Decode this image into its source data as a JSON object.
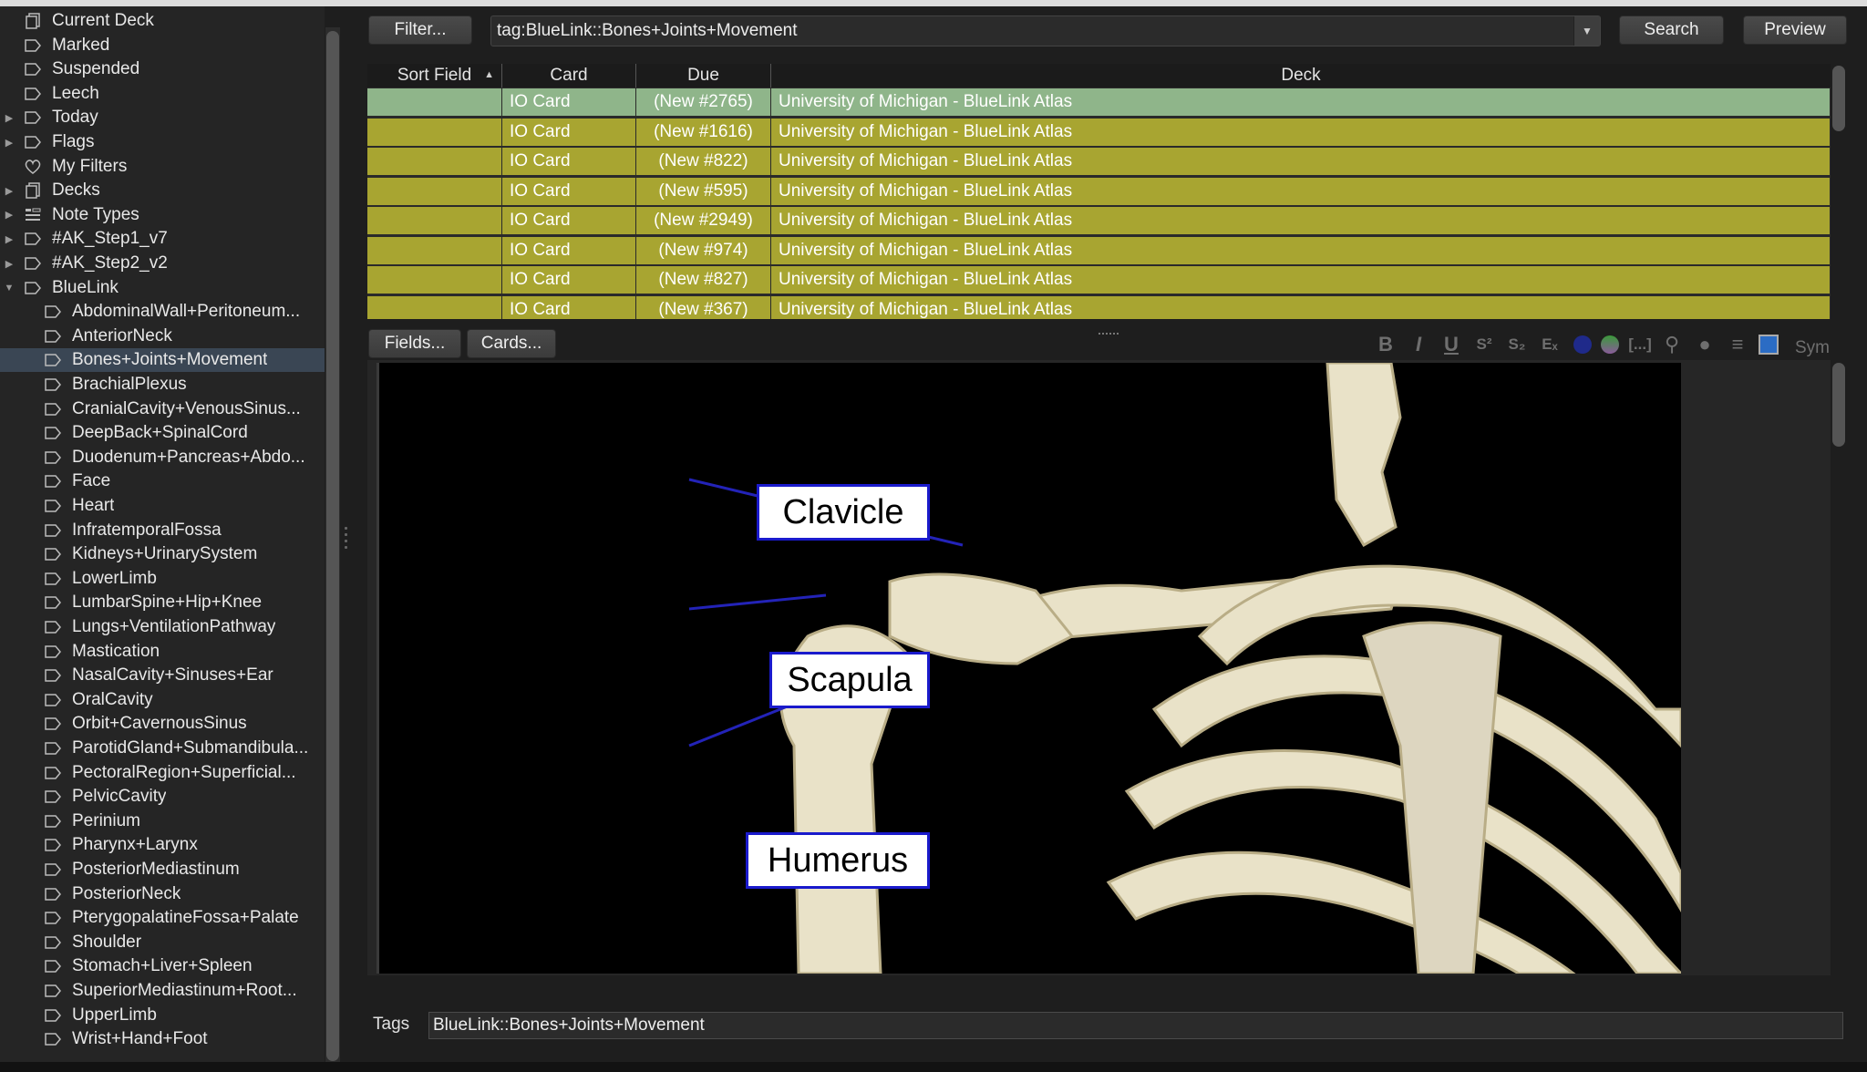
{
  "sidebar": {
    "items": [
      {
        "label": "Current Deck",
        "icon": "deck-icon",
        "level": 0,
        "expandable": false
      },
      {
        "label": "Marked",
        "icon": "tag-icon",
        "level": 0,
        "expandable": false
      },
      {
        "label": "Suspended",
        "icon": "tag-icon",
        "level": 0,
        "expandable": false
      },
      {
        "label": "Leech",
        "icon": "tag-icon",
        "level": 0,
        "expandable": false
      },
      {
        "label": "Today",
        "icon": "tag-icon",
        "level": 0,
        "expandable": true
      },
      {
        "label": "Flags",
        "icon": "tag-icon",
        "level": 0,
        "expandable": true
      },
      {
        "label": "My Filters",
        "icon": "heart-icon",
        "level": 0,
        "expandable": false
      },
      {
        "label": "Decks",
        "icon": "deck-icon",
        "level": 0,
        "expandable": true
      },
      {
        "label": "Note Types",
        "icon": "note-types-icon",
        "level": 0,
        "expandable": true
      },
      {
        "label": "#AK_Step1_v7",
        "icon": "tag-icon",
        "level": 0,
        "expandable": true
      },
      {
        "label": "#AK_Step2_v2",
        "icon": "tag-icon",
        "level": 0,
        "expandable": true
      },
      {
        "label": "BlueLink",
        "icon": "tag-icon",
        "level": 0,
        "expandable": true,
        "expanded": true
      },
      {
        "label": "AbdominalWall+Peritoneum...",
        "icon": "tag-icon",
        "level": 1
      },
      {
        "label": "AnteriorNeck",
        "icon": "tag-icon",
        "level": 1
      },
      {
        "label": "Bones+Joints+Movement",
        "icon": "tag-icon",
        "level": 1,
        "selected": true
      },
      {
        "label": "BrachialPlexus",
        "icon": "tag-icon",
        "level": 1
      },
      {
        "label": "CranialCavity+VenousSinus...",
        "icon": "tag-icon",
        "level": 1
      },
      {
        "label": "DeepBack+SpinalCord",
        "icon": "tag-icon",
        "level": 1
      },
      {
        "label": "Duodenum+Pancreas+Abdo...",
        "icon": "tag-icon",
        "level": 1
      },
      {
        "label": "Face",
        "icon": "tag-icon",
        "level": 1
      },
      {
        "label": "Heart",
        "icon": "tag-icon",
        "level": 1
      },
      {
        "label": "InfratemporalFossa",
        "icon": "tag-icon",
        "level": 1
      },
      {
        "label": "Kidneys+UrinarySystem",
        "icon": "tag-icon",
        "level": 1
      },
      {
        "label": "LowerLimb",
        "icon": "tag-icon",
        "level": 1
      },
      {
        "label": "LumbarSpine+Hip+Knee",
        "icon": "tag-icon",
        "level": 1
      },
      {
        "label": "Lungs+VentilationPathway",
        "icon": "tag-icon",
        "level": 1
      },
      {
        "label": "Mastication",
        "icon": "tag-icon",
        "level": 1
      },
      {
        "label": "NasalCavity+Sinuses+Ear",
        "icon": "tag-icon",
        "level": 1
      },
      {
        "label": "OralCavity",
        "icon": "tag-icon",
        "level": 1
      },
      {
        "label": "Orbit+CavernousSinus",
        "icon": "tag-icon",
        "level": 1
      },
      {
        "label": "ParotidGland+Submandibula...",
        "icon": "tag-icon",
        "level": 1
      },
      {
        "label": "PectoralRegion+Superficial...",
        "icon": "tag-icon",
        "level": 1
      },
      {
        "label": "PelvicCavity",
        "icon": "tag-icon",
        "level": 1
      },
      {
        "label": "Perinium",
        "icon": "tag-icon",
        "level": 1
      },
      {
        "label": "Pharynx+Larynx",
        "icon": "tag-icon",
        "level": 1
      },
      {
        "label": "PosteriorMediastinum",
        "icon": "tag-icon",
        "level": 1
      },
      {
        "label": "PosteriorNeck",
        "icon": "tag-icon",
        "level": 1
      },
      {
        "label": "PterygopalatineFossa+Palate",
        "icon": "tag-icon",
        "level": 1
      },
      {
        "label": "Shoulder",
        "icon": "tag-icon",
        "level": 1
      },
      {
        "label": "Stomach+Liver+Spleen",
        "icon": "tag-icon",
        "level": 1
      },
      {
        "label": "SuperiorMediastinum+Root...",
        "icon": "tag-icon",
        "level": 1
      },
      {
        "label": "UpperLimb",
        "icon": "tag-icon",
        "level": 1
      },
      {
        "label": "Wrist+Hand+Foot",
        "icon": "tag-icon",
        "level": 1
      }
    ]
  },
  "search": {
    "filter_label": "Filter...",
    "query": "tag:BlueLink::Bones+Joints+Movement",
    "search_label": "Search",
    "preview_label": "Preview"
  },
  "table": {
    "columns": [
      "Sort Field",
      "Card",
      "Due",
      "Deck"
    ],
    "sort_column": "Sort Field",
    "rows": [
      {
        "sort_field": "",
        "card": "IO Card",
        "due": "(New #2765)",
        "deck": "University of Michigan - BlueLink Atlas",
        "selected": true
      },
      {
        "sort_field": "",
        "card": "IO Card",
        "due": "(New #1616)",
        "deck": "University of Michigan - BlueLink Atlas"
      },
      {
        "sort_field": "",
        "card": "IO Card",
        "due": "(New #822)",
        "deck": "University of Michigan - BlueLink Atlas"
      },
      {
        "sort_field": "",
        "card": "IO Card",
        "due": "(New #595)",
        "deck": "University of Michigan - BlueLink Atlas"
      },
      {
        "sort_field": "",
        "card": "IO Card",
        "due": "(New #2949)",
        "deck": "University of Michigan - BlueLink Atlas"
      },
      {
        "sort_field": "",
        "card": "IO Card",
        "due": "(New #974)",
        "deck": "University of Michigan - BlueLink Atlas"
      },
      {
        "sort_field": "",
        "card": "IO Card",
        "due": "(New #827)",
        "deck": "University of Michigan - BlueLink Atlas"
      },
      {
        "sort_field": "",
        "card": "IO Card",
        "due": "(New #367)",
        "deck": "University of Michigan - BlueLink Atlas"
      }
    ]
  },
  "editor": {
    "fields_label": "Fields...",
    "cards_label": "Cards...",
    "toolbar": [
      {
        "name": "bold-icon",
        "glyph": "B"
      },
      {
        "name": "italic-icon",
        "glyph": "I"
      },
      {
        "name": "underline-icon",
        "glyph": "U"
      },
      {
        "name": "superscript-icon",
        "glyph": "S²"
      },
      {
        "name": "subscript-icon",
        "glyph": "S₂"
      },
      {
        "name": "clear-format-icon",
        "glyph": "Eₓ"
      },
      {
        "name": "text-color-icon",
        "glyph": ""
      },
      {
        "name": "highlight-color-icon",
        "glyph": ""
      },
      {
        "name": "cloze-icon",
        "glyph": "[...]"
      },
      {
        "name": "attach-icon",
        "glyph": "⚲"
      },
      {
        "name": "record-audio-icon",
        "glyph": "●"
      },
      {
        "name": "more-icon",
        "glyph": "≡"
      },
      {
        "name": "image-occlusion-icon",
        "glyph": ""
      },
      {
        "name": "symbols-button",
        "glyph": "Sym"
      }
    ],
    "image_labels": [
      "Clavicle",
      "Scapula",
      "Humerus"
    ],
    "label_box_color": "#1a1acc",
    "tags_label": "Tags",
    "tags_value": "BlueLink::Bones+Joints+Movement"
  },
  "colors": {
    "row_highlight": "#a8a531",
    "row_selected": "#8fb58a",
    "sidebar_selected": "#3a4654"
  }
}
